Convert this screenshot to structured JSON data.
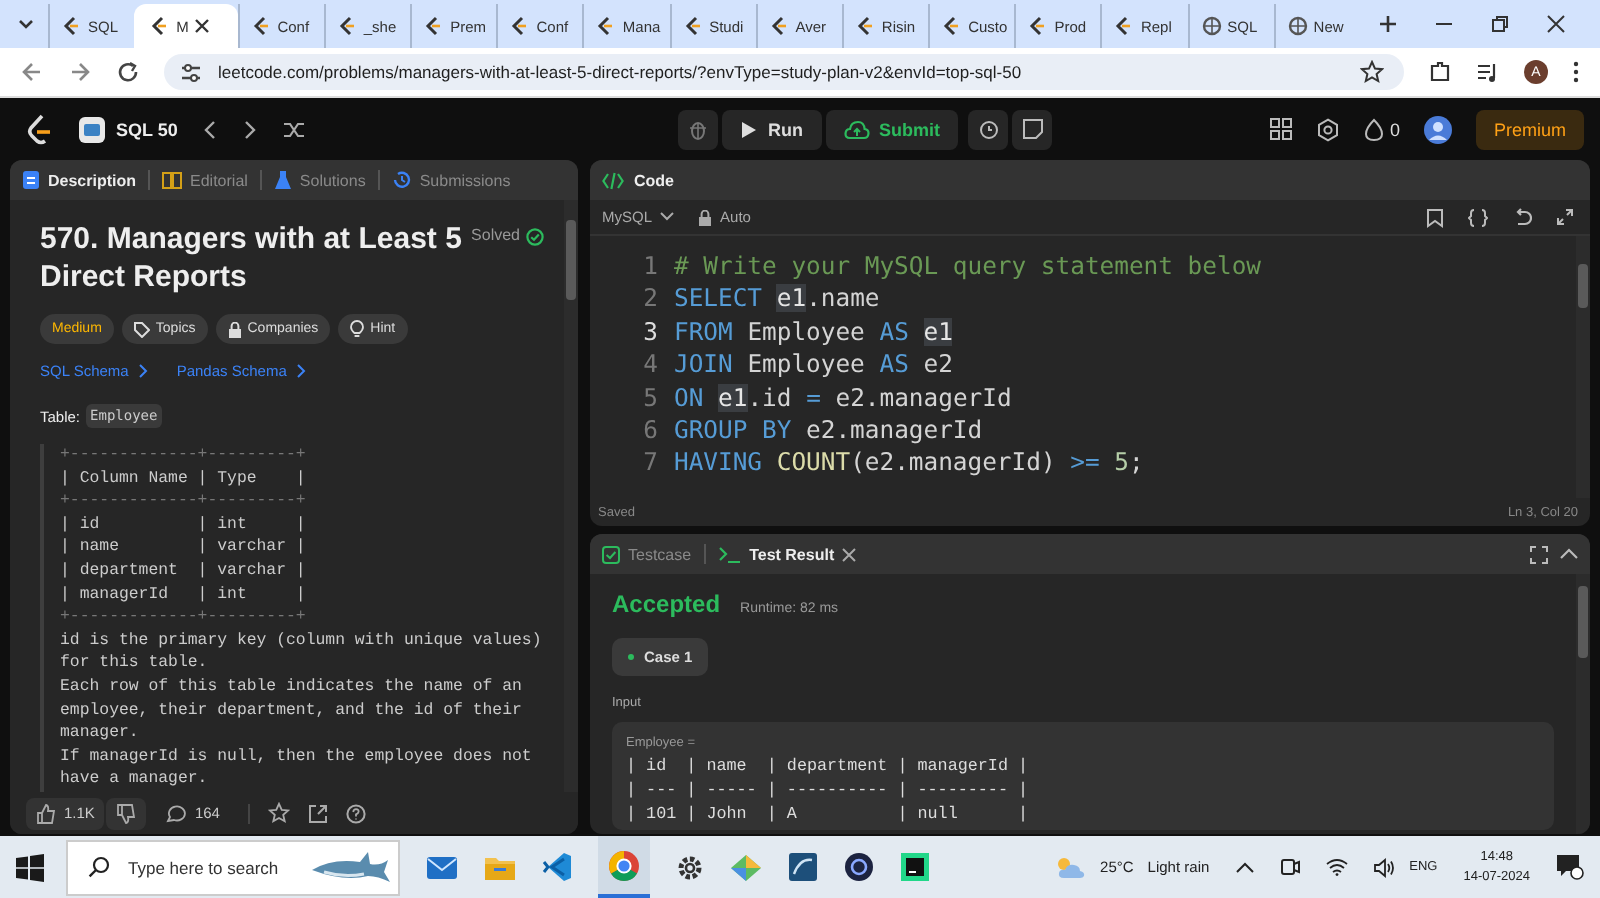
{
  "browser": {
    "tabs": [
      {
        "label": "SQL",
        "selected": false
      },
      {
        "label": "M",
        "selected": true
      },
      {
        "label": "Conf",
        "selected": false
      },
      {
        "label": "_she",
        "selected": false
      },
      {
        "label": "Prem",
        "selected": false
      },
      {
        "label": "Conf",
        "selected": false
      },
      {
        "label": "Mana",
        "selected": false
      },
      {
        "label": "Studi",
        "selected": false
      },
      {
        "label": "Aver",
        "selected": false
      },
      {
        "label": "Risin",
        "selected": false
      },
      {
        "label": "Custo",
        "selected": false
      },
      {
        "label": "Prod",
        "selected": false
      },
      {
        "label": "Repl",
        "selected": false
      },
      {
        "label": "SQL",
        "selected": false
      },
      {
        "label": "New",
        "selected": false
      }
    ],
    "url": "leetcode.com/problems/managers-with-at-least-5-direct-reports/?envType=study-plan-v2&envId=top-sql-50",
    "profile": "A"
  },
  "topbar": {
    "study_plan": "SQL 50",
    "run": "Run",
    "submit": "Submit",
    "streak": "0",
    "premium": "Premium"
  },
  "description_panel": {
    "tabs": [
      {
        "label": "Description",
        "selected": true
      },
      {
        "label": "Editorial",
        "selected": false
      },
      {
        "label": "Solutions",
        "selected": false
      },
      {
        "label": "Submissions",
        "selected": false
      }
    ],
    "title": "570. Managers with at Least 5 Direct Reports",
    "status": "Solved",
    "tags": [
      {
        "label": "Medium",
        "kind": "difficulty"
      },
      {
        "label": "Topics",
        "kind": "topics"
      },
      {
        "label": "Companies",
        "kind": "companies"
      },
      {
        "label": "Hint",
        "kind": "hint"
      }
    ],
    "links": [
      "SQL Schema",
      "Pandas Schema"
    ],
    "table_label": "Table:",
    "table_name": "Employee",
    "schema_lines": [
      "+-------------+---------+",
      "| Column Name | Type    |",
      "+-------------+---------+",
      "| id          | int     |",
      "| name        | varchar |",
      "| department  | varchar |",
      "| managerId   | int     |",
      "+-------------+---------+"
    ],
    "paragraphs": [
      "id is the primary key (column with unique values) for this table.",
      "Each row of this table indicates the name of an employee, their department, and the id of their manager.",
      "If managerId is null, then the employee does not have a manager."
    ],
    "likes": "1.1K",
    "comments": "164"
  },
  "code_panel": {
    "title": "Code",
    "language": "MySQL",
    "mode": "Auto",
    "lines": [
      {
        "number": "1",
        "current": false,
        "tokens": [
          {
            "text": "# Write your MySQL query statement below",
            "kind": "comment"
          }
        ]
      },
      {
        "number": "2",
        "current": false,
        "tokens": [
          {
            "text": "SELECT ",
            "kind": "keyword"
          },
          {
            "text": "e1",
            "kind": "match"
          },
          {
            "text": ".name",
            "kind": "plain"
          }
        ]
      },
      {
        "number": "3",
        "current": true,
        "tokens": [
          {
            "text": "FROM ",
            "kind": "keyword"
          },
          {
            "text": "Employee ",
            "kind": "plain"
          },
          {
            "text": "AS ",
            "kind": "keyword"
          },
          {
            "text": "e1",
            "kind": "match"
          }
        ]
      },
      {
        "number": "4",
        "current": false,
        "tokens": [
          {
            "text": "JOIN ",
            "kind": "keyword"
          },
          {
            "text": "Employee ",
            "kind": "plain"
          },
          {
            "text": "AS ",
            "kind": "keyword"
          },
          {
            "text": "e2",
            "kind": "plain"
          }
        ]
      },
      {
        "number": "5",
        "current": false,
        "tokens": [
          {
            "text": "ON ",
            "kind": "keyword"
          },
          {
            "text": "e1",
            "kind": "match"
          },
          {
            "text": ".id ",
            "kind": "plain"
          },
          {
            "text": "= ",
            "kind": "operator"
          },
          {
            "text": "e2.managerId",
            "kind": "plain"
          }
        ]
      },
      {
        "number": "6",
        "current": false,
        "tokens": [
          {
            "text": "GROUP BY ",
            "kind": "keyword"
          },
          {
            "text": "e2.managerId",
            "kind": "plain"
          }
        ]
      },
      {
        "number": "7",
        "current": false,
        "tokens": [
          {
            "text": "HAVING ",
            "kind": "keyword"
          },
          {
            "text": "COUNT",
            "kind": "function"
          },
          {
            "text": "(e2.managerId) ",
            "kind": "plain"
          },
          {
            "text": ">= ",
            "kind": "operator"
          },
          {
            "text": "5",
            "kind": "number"
          },
          {
            "text": ";",
            "kind": "plain"
          }
        ]
      }
    ],
    "status": "Saved",
    "cursor": "Ln 3, Col 20"
  },
  "result_panel": {
    "tabs": [
      {
        "label": "Testcase",
        "selected": false
      },
      {
        "label": "Test Result",
        "selected": true
      }
    ],
    "verdict": "Accepted",
    "runtime": "Runtime: 82 ms",
    "cases": [
      {
        "label": "Case 1",
        "selected": true
      }
    ],
    "input_label": "Input",
    "variable": "Employee =",
    "table_lines": [
      "| id  | name  | department | managerId |",
      "| --- | ----- | ---------- | --------- |",
      "| 101 | John  | A          | null      |"
    ]
  },
  "taskbar": {
    "search_placeholder": "Type here to search",
    "temperature": "25°C",
    "weather": "Light rain",
    "language": "ENG",
    "time": "14:48",
    "date": "14-07-2024"
  }
}
